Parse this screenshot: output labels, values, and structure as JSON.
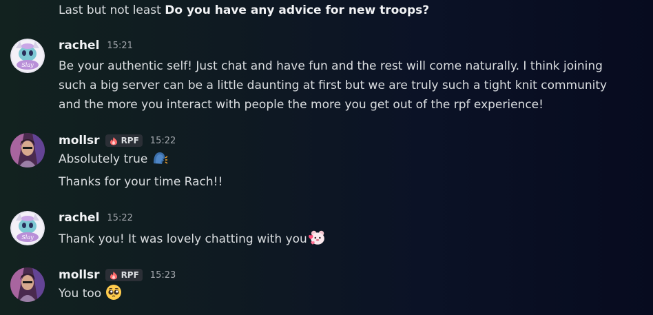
{
  "messages": {
    "m0": {
      "text_prefix": "Last but not least ",
      "text_bold": "Do you have any advice for new troops?"
    },
    "m1": {
      "username": "rachel",
      "time": "15:21",
      "text": "Be your authentic self! Just chat and have fun and the rest will come naturally. I think joining such a big server can be a little daunting at first but we are truly such a tight knit community and the more you interact with people the more you get out of the rpf experience!"
    },
    "m2": {
      "username": "mollsr",
      "tag": "RPF",
      "time": "15:22",
      "line1": "Absolutely true",
      "line2": "Thanks for your time Rach!!"
    },
    "m3": {
      "username": "rachel",
      "time": "15:22",
      "text": "Thank you! It was lovely chatting with you"
    },
    "m4": {
      "username": "mollsr",
      "tag": "RPF",
      "time": "15:23",
      "text": "You too"
    }
  },
  "icons": {
    "speaking": "speaking-head-emoji",
    "hearts": "heart-bear-emoji",
    "pleading": "pleading-face-emoji",
    "tag": "flame-badge-icon"
  },
  "colors": {
    "username": "#f2f3f5",
    "text": "#dbdee1",
    "timestamp": "#a4a8ae",
    "tag_bg": "#2b2f36"
  }
}
